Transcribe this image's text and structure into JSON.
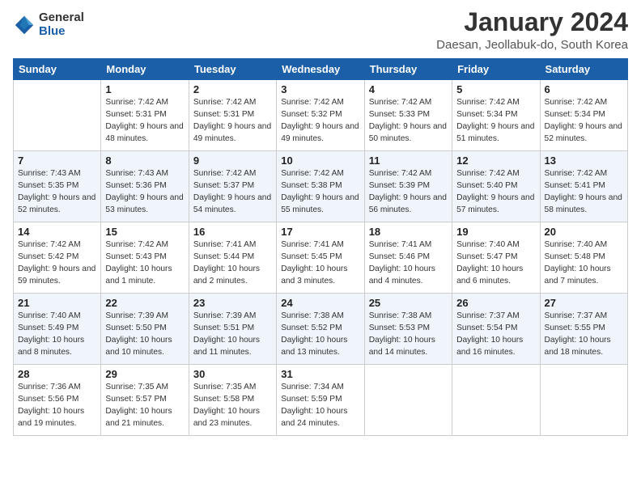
{
  "header": {
    "logo_line1": "General",
    "logo_line2": "Blue",
    "month_title": "January 2024",
    "location": "Daesan, Jeollabuk-do, South Korea"
  },
  "weekdays": [
    "Sunday",
    "Monday",
    "Tuesday",
    "Wednesday",
    "Thursday",
    "Friday",
    "Saturday"
  ],
  "weeks": [
    [
      {
        "day": "",
        "sunrise": "",
        "sunset": "",
        "daylight": ""
      },
      {
        "day": "1",
        "sunrise": "Sunrise: 7:42 AM",
        "sunset": "Sunset: 5:31 PM",
        "daylight": "Daylight: 9 hours and 48 minutes."
      },
      {
        "day": "2",
        "sunrise": "Sunrise: 7:42 AM",
        "sunset": "Sunset: 5:31 PM",
        "daylight": "Daylight: 9 hours and 49 minutes."
      },
      {
        "day": "3",
        "sunrise": "Sunrise: 7:42 AM",
        "sunset": "Sunset: 5:32 PM",
        "daylight": "Daylight: 9 hours and 49 minutes."
      },
      {
        "day": "4",
        "sunrise": "Sunrise: 7:42 AM",
        "sunset": "Sunset: 5:33 PM",
        "daylight": "Daylight: 9 hours and 50 minutes."
      },
      {
        "day": "5",
        "sunrise": "Sunrise: 7:42 AM",
        "sunset": "Sunset: 5:34 PM",
        "daylight": "Daylight: 9 hours and 51 minutes."
      },
      {
        "day": "6",
        "sunrise": "Sunrise: 7:42 AM",
        "sunset": "Sunset: 5:34 PM",
        "daylight": "Daylight: 9 hours and 52 minutes."
      }
    ],
    [
      {
        "day": "7",
        "sunrise": "Sunrise: 7:43 AM",
        "sunset": "Sunset: 5:35 PM",
        "daylight": "Daylight: 9 hours and 52 minutes."
      },
      {
        "day": "8",
        "sunrise": "Sunrise: 7:43 AM",
        "sunset": "Sunset: 5:36 PM",
        "daylight": "Daylight: 9 hours and 53 minutes."
      },
      {
        "day": "9",
        "sunrise": "Sunrise: 7:42 AM",
        "sunset": "Sunset: 5:37 PM",
        "daylight": "Daylight: 9 hours and 54 minutes."
      },
      {
        "day": "10",
        "sunrise": "Sunrise: 7:42 AM",
        "sunset": "Sunset: 5:38 PM",
        "daylight": "Daylight: 9 hours and 55 minutes."
      },
      {
        "day": "11",
        "sunrise": "Sunrise: 7:42 AM",
        "sunset": "Sunset: 5:39 PM",
        "daylight": "Daylight: 9 hours and 56 minutes."
      },
      {
        "day": "12",
        "sunrise": "Sunrise: 7:42 AM",
        "sunset": "Sunset: 5:40 PM",
        "daylight": "Daylight: 9 hours and 57 minutes."
      },
      {
        "day": "13",
        "sunrise": "Sunrise: 7:42 AM",
        "sunset": "Sunset: 5:41 PM",
        "daylight": "Daylight: 9 hours and 58 minutes."
      }
    ],
    [
      {
        "day": "14",
        "sunrise": "Sunrise: 7:42 AM",
        "sunset": "Sunset: 5:42 PM",
        "daylight": "Daylight: 9 hours and 59 minutes."
      },
      {
        "day": "15",
        "sunrise": "Sunrise: 7:42 AM",
        "sunset": "Sunset: 5:43 PM",
        "daylight": "Daylight: 10 hours and 1 minute."
      },
      {
        "day": "16",
        "sunrise": "Sunrise: 7:41 AM",
        "sunset": "Sunset: 5:44 PM",
        "daylight": "Daylight: 10 hours and 2 minutes."
      },
      {
        "day": "17",
        "sunrise": "Sunrise: 7:41 AM",
        "sunset": "Sunset: 5:45 PM",
        "daylight": "Daylight: 10 hours and 3 minutes."
      },
      {
        "day": "18",
        "sunrise": "Sunrise: 7:41 AM",
        "sunset": "Sunset: 5:46 PM",
        "daylight": "Daylight: 10 hours and 4 minutes."
      },
      {
        "day": "19",
        "sunrise": "Sunrise: 7:40 AM",
        "sunset": "Sunset: 5:47 PM",
        "daylight": "Daylight: 10 hours and 6 minutes."
      },
      {
        "day": "20",
        "sunrise": "Sunrise: 7:40 AM",
        "sunset": "Sunset: 5:48 PM",
        "daylight": "Daylight: 10 hours and 7 minutes."
      }
    ],
    [
      {
        "day": "21",
        "sunrise": "Sunrise: 7:40 AM",
        "sunset": "Sunset: 5:49 PM",
        "daylight": "Daylight: 10 hours and 8 minutes."
      },
      {
        "day": "22",
        "sunrise": "Sunrise: 7:39 AM",
        "sunset": "Sunset: 5:50 PM",
        "daylight": "Daylight: 10 hours and 10 minutes."
      },
      {
        "day": "23",
        "sunrise": "Sunrise: 7:39 AM",
        "sunset": "Sunset: 5:51 PM",
        "daylight": "Daylight: 10 hours and 11 minutes."
      },
      {
        "day": "24",
        "sunrise": "Sunrise: 7:38 AM",
        "sunset": "Sunset: 5:52 PM",
        "daylight": "Daylight: 10 hours and 13 minutes."
      },
      {
        "day": "25",
        "sunrise": "Sunrise: 7:38 AM",
        "sunset": "Sunset: 5:53 PM",
        "daylight": "Daylight: 10 hours and 14 minutes."
      },
      {
        "day": "26",
        "sunrise": "Sunrise: 7:37 AM",
        "sunset": "Sunset: 5:54 PM",
        "daylight": "Daylight: 10 hours and 16 minutes."
      },
      {
        "day": "27",
        "sunrise": "Sunrise: 7:37 AM",
        "sunset": "Sunset: 5:55 PM",
        "daylight": "Daylight: 10 hours and 18 minutes."
      }
    ],
    [
      {
        "day": "28",
        "sunrise": "Sunrise: 7:36 AM",
        "sunset": "Sunset: 5:56 PM",
        "daylight": "Daylight: 10 hours and 19 minutes."
      },
      {
        "day": "29",
        "sunrise": "Sunrise: 7:35 AM",
        "sunset": "Sunset: 5:57 PM",
        "daylight": "Daylight: 10 hours and 21 minutes."
      },
      {
        "day": "30",
        "sunrise": "Sunrise: 7:35 AM",
        "sunset": "Sunset: 5:58 PM",
        "daylight": "Daylight: 10 hours and 23 minutes."
      },
      {
        "day": "31",
        "sunrise": "Sunrise: 7:34 AM",
        "sunset": "Sunset: 5:59 PM",
        "daylight": "Daylight: 10 hours and 24 minutes."
      },
      {
        "day": "",
        "sunrise": "",
        "sunset": "",
        "daylight": ""
      },
      {
        "day": "",
        "sunrise": "",
        "sunset": "",
        "daylight": ""
      },
      {
        "day": "",
        "sunrise": "",
        "sunset": "",
        "daylight": ""
      }
    ]
  ]
}
